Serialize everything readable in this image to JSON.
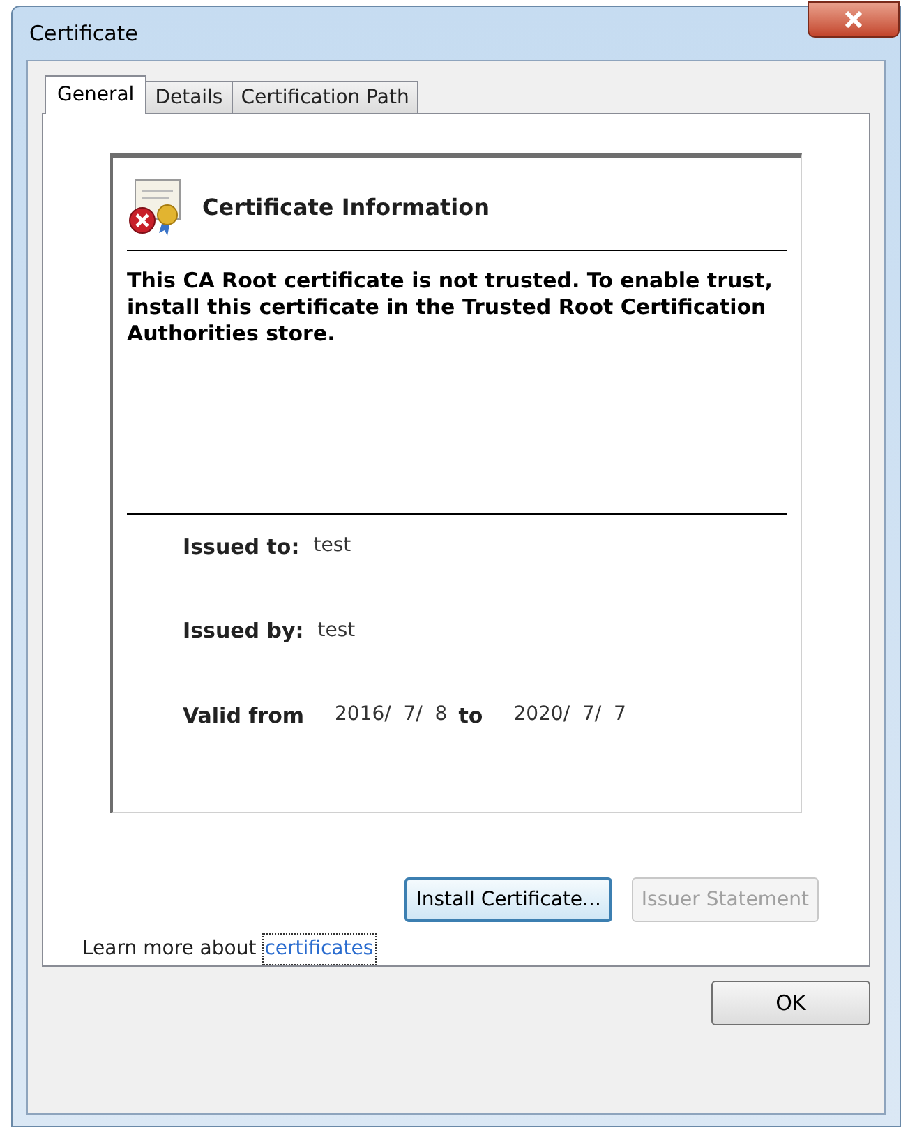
{
  "window": {
    "title": "Certificate"
  },
  "tabs": [
    {
      "label": "General",
      "selected": true
    },
    {
      "label": "Details",
      "selected": false
    },
    {
      "label": "Certification Path",
      "selected": false
    }
  ],
  "info": {
    "title": "Certificate Information",
    "message": "This CA Root certificate is not trusted. To enable trust, install this certificate in the Trusted Root Certification Authorities store.",
    "fields": [
      {
        "label": "Issued to:",
        "value": "test"
      },
      {
        "label": "Issued by:",
        "value": "test"
      }
    ],
    "validity": {
      "label": "Valid from",
      "from": "2016/  7/  8",
      "joiner": "to",
      "to": "2020/  7/  7"
    }
  },
  "buttons": [
    {
      "label": "Install Certificate...",
      "disabled": false,
      "focused": true
    },
    {
      "label": "Issuer Statement",
      "disabled": true,
      "focused": false
    }
  ],
  "learn_more": {
    "text": "Learn more about",
    "link": "certificates"
  },
  "footer_buttons": [
    {
      "label": "OK"
    }
  ]
}
